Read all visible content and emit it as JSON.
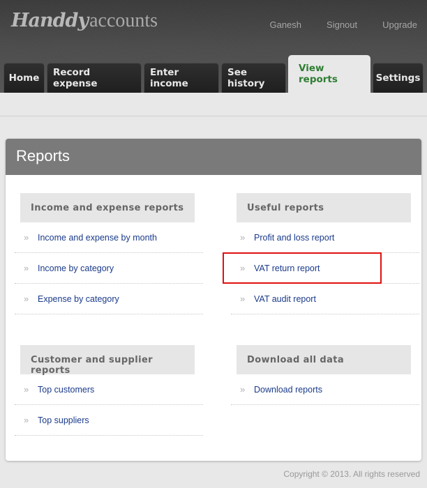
{
  "app": {
    "logo_script": "Handdy",
    "logo_plain": "accounts"
  },
  "top_links": {
    "user": "Ganesh",
    "signout": "Signout",
    "upgrade": "Upgrade"
  },
  "tabs": [
    {
      "label": "Home",
      "active": false
    },
    {
      "label": "Record expense",
      "active": false
    },
    {
      "label": "Enter income",
      "active": false
    },
    {
      "label": "See history",
      "active": false
    },
    {
      "label": "View reports",
      "active": true
    },
    {
      "label": "Settings",
      "active": false
    }
  ],
  "panel": {
    "title": "Reports",
    "sections": [
      {
        "title": "Income and expense reports",
        "links": [
          "Income and expense by month",
          "Income by category",
          "Expense by category"
        ]
      },
      {
        "title": "Useful reports",
        "links": [
          "Profit and loss report",
          "VAT return report",
          "VAT audit report"
        ],
        "highlighted_link": "VAT return report"
      },
      {
        "title": "Customer and supplier reports",
        "links": [
          "Top customers",
          "Top suppliers"
        ]
      },
      {
        "title": "Download all data",
        "links": [
          "Download reports"
        ]
      }
    ]
  },
  "icons": {
    "link_bullet": "»"
  },
  "colors": {
    "active_tab_text": "#2e7d32",
    "link": "#1a3a8a",
    "highlight_border": "#e01010",
    "panel_header": "#7a7a7a"
  },
  "footer": {
    "copyright": "Copyright © 2013. All rights reserved"
  }
}
